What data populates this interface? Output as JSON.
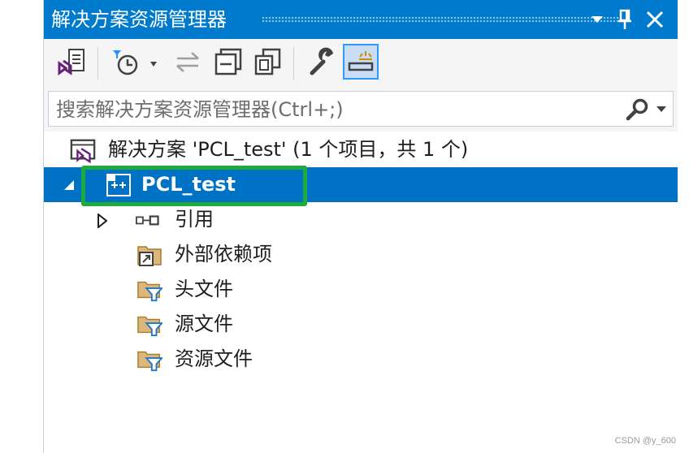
{
  "window": {
    "title": "解决方案资源管理器",
    "dropdown_icon": "chevron-down-icon",
    "pin_icon": "pin-icon",
    "close_icon": "close-icon"
  },
  "toolbar": {
    "items": [
      {
        "name": "vs-solution-view-icon",
        "tooltip": ""
      },
      {
        "name": "pending-changes-filter-icon",
        "tooltip": ""
      },
      {
        "name": "sync-with-active-document-icon",
        "tooltip": ""
      },
      {
        "name": "collapse-all-icon",
        "tooltip": ""
      },
      {
        "name": "show-all-files-icon",
        "tooltip": ""
      },
      {
        "name": "properties-wrench-icon",
        "tooltip": ""
      },
      {
        "name": "preview-selected-items-icon",
        "tooltip": ""
      }
    ]
  },
  "search": {
    "placeholder": "搜索解决方案资源管理器(Ctrl+;)",
    "icon": "search-icon"
  },
  "tree": {
    "solution": {
      "label": "解决方案 'PCL_test' (1 个项目，共 1 个)",
      "icon": "solution-icon"
    },
    "project": {
      "label": "PCL_test",
      "icon": "cpp-project-icon",
      "expanded": true,
      "selected": true
    },
    "children": [
      {
        "label": "引用",
        "icon": "references-icon",
        "expandable": true
      },
      {
        "label": "外部依赖项",
        "icon": "external-dependencies-icon"
      },
      {
        "label": "头文件",
        "icon": "filter-folder-icon"
      },
      {
        "label": "源文件",
        "icon": "filter-folder-icon"
      },
      {
        "label": "资源文件",
        "icon": "filter-folder-icon"
      }
    ]
  },
  "colors": {
    "title_bar": "#007acc",
    "selection": "#0072c6",
    "highlight_frame": "#1faa3c"
  },
  "watermark": "CSDN @y_600"
}
